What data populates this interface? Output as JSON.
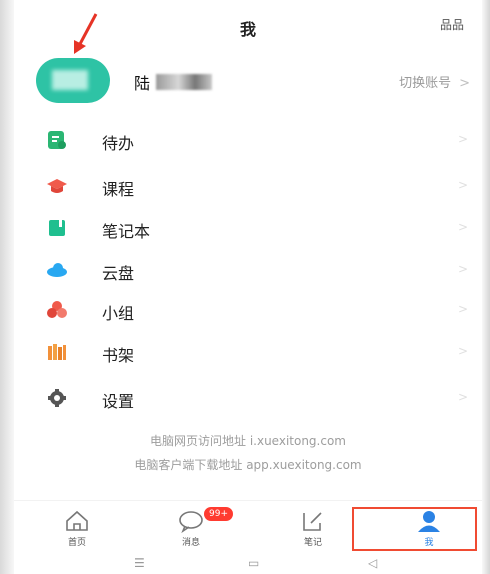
{
  "header": {
    "title": "我",
    "qr_label": "品品"
  },
  "profile": {
    "name_visible": "陆",
    "switch_label": "切换账号"
  },
  "menu": [
    {
      "label": "待办",
      "icon": "todo-icon",
      "color": "#2bb673"
    },
    {
      "label": "课程",
      "icon": "graduation-cap-icon",
      "color": "#f05a4b"
    },
    {
      "label": "笔记本",
      "icon": "notebook-icon",
      "color": "#1fbf8f"
    },
    {
      "label": "云盘",
      "icon": "cloud-icon",
      "color": "#29a8f1"
    },
    {
      "label": "小组",
      "icon": "group-icon",
      "color": "#f05a4b"
    },
    {
      "label": "书架",
      "icon": "bookshelf-icon",
      "color": "#f2913a"
    },
    {
      "label": "设置",
      "icon": "gear-icon",
      "color": "#555555"
    }
  ],
  "footer": {
    "line1": "电脑网页访问地址 i.xuexitong.com",
    "line2": "电脑客户端下载地址 app.xuexitong.com"
  },
  "tabs": [
    {
      "label": "首页",
      "icon": "home-icon"
    },
    {
      "label": "消息",
      "icon": "message-icon",
      "badge": "99+"
    },
    {
      "label": "笔记",
      "icon": "note-edit-icon"
    },
    {
      "label": "我",
      "icon": "user-icon",
      "active": true
    }
  ],
  "colors": {
    "accent": "#2a82e4",
    "highlight_box": "#f04b32",
    "arrow": "#e63326"
  }
}
